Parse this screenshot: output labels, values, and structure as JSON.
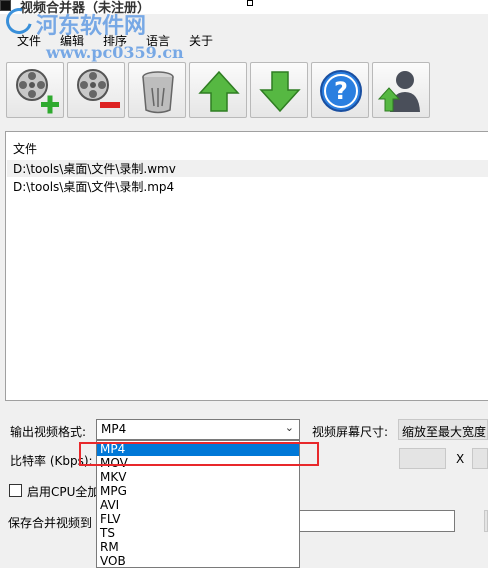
{
  "window": {
    "title": "视频合并器（未注册）"
  },
  "watermark": {
    "line1": "河东软件网",
    "line2": "www.pc0359.cn"
  },
  "menu": {
    "items": [
      "文件",
      "编辑",
      "排序",
      "语言",
      "关于"
    ]
  },
  "toolbar": {
    "buttons": [
      {
        "icon": "film-reel-add-icon"
      },
      {
        "icon": "film-reel-remove-icon"
      },
      {
        "icon": "trash-bin-icon"
      },
      {
        "icon": "arrow-up-icon"
      },
      {
        "icon": "arrow-down-icon"
      },
      {
        "icon": "help-icon"
      },
      {
        "icon": "user-upload-icon"
      }
    ]
  },
  "file_list": {
    "header": "文件",
    "rows": [
      "D:\\tools\\桌面\\文件\\录制.wmv",
      "D:\\tools\\桌面\\文件\\录制.mp4"
    ]
  },
  "output": {
    "format_label": "输出视频格式:",
    "format_value": "MP4",
    "screen_size_label": "视频屏幕尺寸:",
    "screen_size_value": "缩放至最大宽度",
    "bitrate_label": "比特率 (Kbps):",
    "x_label": "X",
    "cpu_label": "启用CPU全加",
    "save_label": "保存合并视频到"
  },
  "format_dropdown": {
    "options": [
      "MP4",
      "MOV",
      "MKV",
      "MPG",
      "AVI",
      "FLV",
      "TS",
      "RM",
      "VOB"
    ],
    "highlighted": "MP4"
  },
  "colors": {
    "highlight": "#0078d7",
    "annotation_box": "#e8282b"
  }
}
